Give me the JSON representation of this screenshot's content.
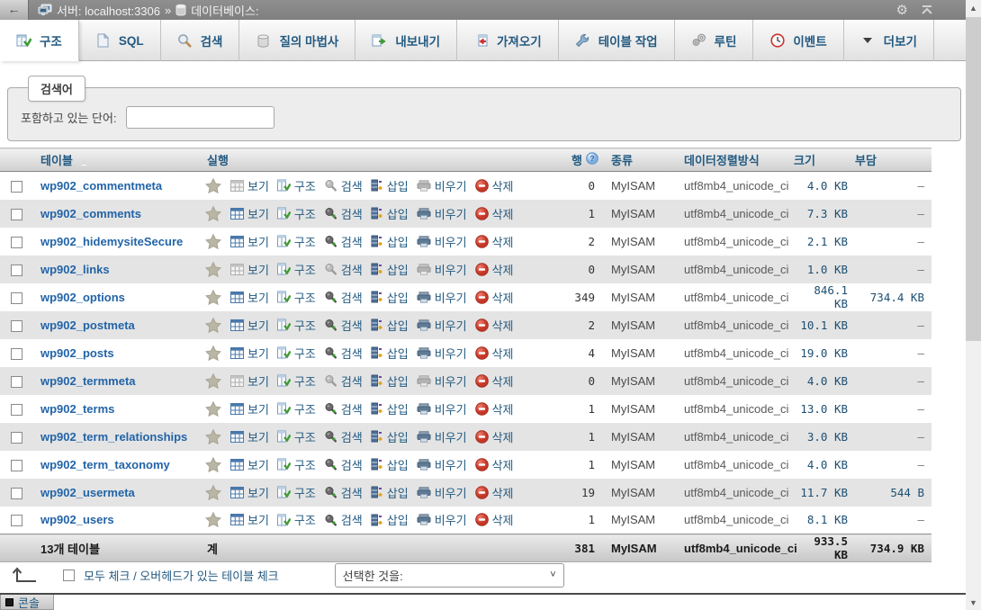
{
  "topbar": {
    "back_label": "←",
    "breadcrumb": {
      "server_label": "서버: localhost:3306",
      "separator": "»",
      "database_label": "데이터베이스:"
    }
  },
  "tabs": [
    {
      "label": "구조",
      "icon": "structure-tab-icon",
      "active": true
    },
    {
      "label": "SQL",
      "icon": "sql-icon",
      "active": false
    },
    {
      "label": "검색",
      "icon": "search-icon",
      "active": false
    },
    {
      "label": "질의 마법사",
      "icon": "query-wizard-icon",
      "active": false
    },
    {
      "label": "내보내기",
      "icon": "export-icon",
      "active": false
    },
    {
      "label": "가져오기",
      "icon": "import-icon",
      "active": false
    },
    {
      "label": "테이블 작업",
      "icon": "operations-icon",
      "active": false
    },
    {
      "label": "루틴",
      "icon": "routines-icon",
      "active": false
    },
    {
      "label": "이벤트",
      "icon": "events-icon",
      "active": false
    },
    {
      "label": "더보기",
      "icon": "more-chevron-icon",
      "active": false
    }
  ],
  "filter": {
    "legend": "검색어",
    "label": "포함하고 있는 단어:",
    "input_value": ""
  },
  "table": {
    "headers": {
      "name": "테이블",
      "actions": "실행",
      "rows": "행",
      "type": "종류",
      "collation": "데이터정렬방식",
      "size": "크기",
      "overhead": "부담"
    },
    "action_labels": [
      {
        "icon": "browse-icon",
        "label": "보기"
      },
      {
        "icon": "structure-icon",
        "label": "구조"
      },
      {
        "icon": "row-search-icon",
        "label": "검색"
      },
      {
        "icon": "insert-icon",
        "label": "삽입"
      },
      {
        "icon": "empty-icon",
        "label": "비우기"
      },
      {
        "icon": "delete-icon",
        "label": "삭제"
      }
    ],
    "rows": [
      {
        "name": "wp902_commentmeta",
        "rows": "0",
        "type": "MyISAM",
        "collation": "utf8mb4_unicode_ci",
        "size": "4.0 KB",
        "overhead": "–"
      },
      {
        "name": "wp902_comments",
        "rows": "1",
        "type": "MyISAM",
        "collation": "utf8mb4_unicode_ci",
        "size": "7.3 KB",
        "overhead": "–"
      },
      {
        "name": "wp902_hidemysiteSecure",
        "rows": "2",
        "type": "MyISAM",
        "collation": "utf8mb4_unicode_ci",
        "size": "2.1 KB",
        "overhead": "–"
      },
      {
        "name": "wp902_links",
        "rows": "0",
        "type": "MyISAM",
        "collation": "utf8mb4_unicode_ci",
        "size": "1.0 KB",
        "overhead": "–"
      },
      {
        "name": "wp902_options",
        "rows": "349",
        "type": "MyISAM",
        "collation": "utf8mb4_unicode_ci",
        "size": "846.1 KB",
        "overhead": "734.4 KB"
      },
      {
        "name": "wp902_postmeta",
        "rows": "2",
        "type": "MyISAM",
        "collation": "utf8mb4_unicode_ci",
        "size": "10.1 KB",
        "overhead": "–"
      },
      {
        "name": "wp902_posts",
        "rows": "4",
        "type": "MyISAM",
        "collation": "utf8mb4_unicode_ci",
        "size": "19.0 KB",
        "overhead": "–"
      },
      {
        "name": "wp902_termmeta",
        "rows": "0",
        "type": "MyISAM",
        "collation": "utf8mb4_unicode_ci",
        "size": "4.0 KB",
        "overhead": "–"
      },
      {
        "name": "wp902_terms",
        "rows": "1",
        "type": "MyISAM",
        "collation": "utf8mb4_unicode_ci",
        "size": "13.0 KB",
        "overhead": "–"
      },
      {
        "name": "wp902_term_relationships",
        "rows": "1",
        "type": "MyISAM",
        "collation": "utf8mb4_unicode_ci",
        "size": "3.0 KB",
        "overhead": "–"
      },
      {
        "name": "wp902_term_taxonomy",
        "rows": "1",
        "type": "MyISAM",
        "collation": "utf8mb4_unicode_ci",
        "size": "4.0 KB",
        "overhead": "–"
      },
      {
        "name": "wp902_usermeta",
        "rows": "19",
        "type": "MyISAM",
        "collation": "utf8mb4_unicode_ci",
        "size": "11.7 KB",
        "overhead": "544 B"
      },
      {
        "name": "wp902_users",
        "rows": "1",
        "type": "MyISAM",
        "collation": "utf8mb4_unicode_ci",
        "size": "8.1 KB",
        "overhead": "–"
      }
    ],
    "footer": {
      "count": "13개 테이블",
      "total_label": "계",
      "rows": "381",
      "type": "MyISAM",
      "collation": "utf8mb4_unicode_ci",
      "size": "933.5 KB",
      "overhead": "734.9 KB"
    }
  },
  "bottom": {
    "check_all_label": "모두 체크 / 오버헤드가 있는 테이블 체크",
    "with_selected_label": "선택한 것을:"
  },
  "console": {
    "label": "콘솔"
  },
  "colors": {
    "accent": "#235a81",
    "table_link": "#2264a8",
    "delete_red": "#d04437",
    "row_alt": "#e4e4e4",
    "topbar_bg": "#868686"
  }
}
